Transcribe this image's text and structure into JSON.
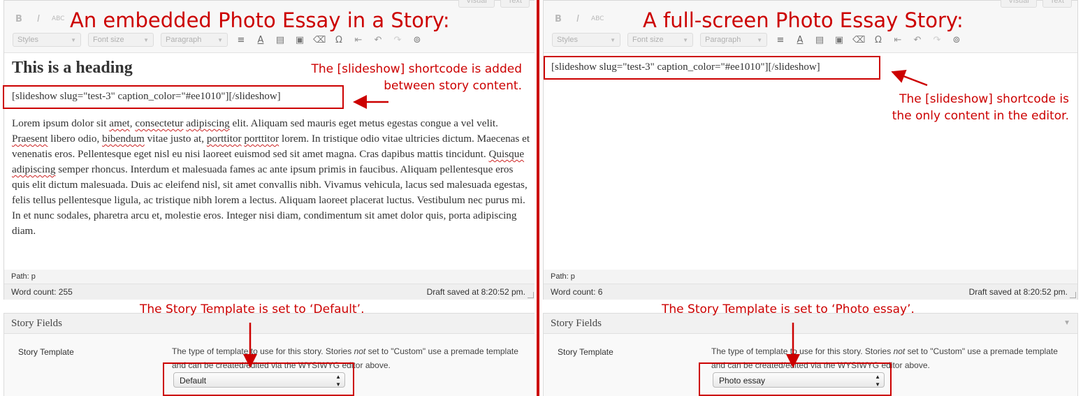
{
  "left": {
    "title": "An embedded Photo Essay in a Story:",
    "editor": {
      "top_tabs": [
        "Visual",
        "Text"
      ],
      "toolbar_selects": [
        "Styles",
        "Font size",
        "Paragraph"
      ],
      "heading": "This is a heading",
      "shortcode": "[slideshow slug=\"test-3\" caption_color=\"#ee1010\"][/slideshow]",
      "paragraph": {
        "p1": "Lorem ipsum dolor sit ",
        "w_amet": "amet",
        "p2": ", ",
        "w_consectetur": "consectetur",
        "p3": " ",
        "w_adipiscing": "adipiscing",
        "p4": " elit. Aliquam sed mauris eget metus egestas congue a vel velit. ",
        "w_praesent": "Praesent",
        "p5": " libero odio, ",
        "w_bibendum": "bibendum",
        "p6": " vitae justo at, ",
        "w_porttitor1": "porttitor",
        "p7": " ",
        "w_porttitor2": "porttitor",
        "p8": " lorem. In tristique odio vitae ultricies dictum. Maecenas et venenatis eros. Pellentesque eget nisl eu nisi laoreet euismod sed sit amet magna. Cras dapibus mattis tincidunt. ",
        "w_quisque": "Quisque",
        "p9": " ",
        "w_adipiscing2": "adipiscing",
        "p10": " semper rhoncus. Interdum et malesuada fames ac ante ipsum primis in faucibus. Aliquam pellentesque eros quis elit dictum malesuada. Duis ac eleifend nisl, sit amet convallis nibh. Vivamus vehicula, lacus sed malesuada egestas, felis tellus pellentesque ligula, ac tristique nibh lorem a lectus. Aliquam laoreet placerat luctus. Vestibulum nec purus mi. In et nunc sodales, pharetra arcu et, molestie eros. Integer nisi diam, condimentum sit amet dolor quis, porta adipiscing diam."
      },
      "path": "Path: p",
      "word_count": "Word count: 255",
      "draft_saved": "Draft saved at 8:20:52 pm."
    },
    "shortcode_note": [
      "The [slideshow] shortcode is added",
      "between story content."
    ],
    "template_note": "The Story Template is set to ‘Default’.",
    "fields": {
      "header": "Story Fields",
      "label": "Story Template",
      "desc_1": "The type of template to use for this story. Stories ",
      "desc_not": "not",
      "desc_2": " set to \"Custom\" use a premade template and can be created/edited via the WYSIWYG editor above.",
      "selected": "Default"
    }
  },
  "right": {
    "title": "A full-screen Photo Essay Story:",
    "editor": {
      "top_tabs": [
        "Visual",
        "Text"
      ],
      "toolbar_selects": [
        "Styles",
        "Font size",
        "Paragraph"
      ],
      "shortcode": "[slideshow slug=\"test-3\" caption_color=\"#ee1010\"][/slideshow]",
      "path": "Path: p",
      "word_count": "Word count: 6",
      "draft_saved": "Draft saved at 8:20:52 pm."
    },
    "shortcode_note": [
      "The [slideshow] shortcode is",
      "the only content in the editor."
    ],
    "template_note": "The Story Template is set to ‘Photo essay’.",
    "fields": {
      "header": "Story Fields",
      "label": "Story Template",
      "desc_1": "The type of template to use for this story. Stories ",
      "desc_not": "not",
      "desc_2": " set to \"Custom\" use a premade template and can be created/edited via the WYSIWYG editor above.",
      "selected": "Photo essay"
    }
  },
  "colors": {
    "annotation": "#cc0000",
    "spellcheck": "#cc2222"
  },
  "icons": [
    "bold-icon",
    "italic-icon",
    "strikethrough-icon",
    "align-justify-icon",
    "text-color-icon",
    "paste-text-icon",
    "paste-word-icon",
    "clear-formatting-icon",
    "special-character-icon",
    "outdent-icon",
    "undo-icon",
    "redo-icon",
    "help-icon",
    "resize-grip-icon",
    "arrow-icon"
  ]
}
